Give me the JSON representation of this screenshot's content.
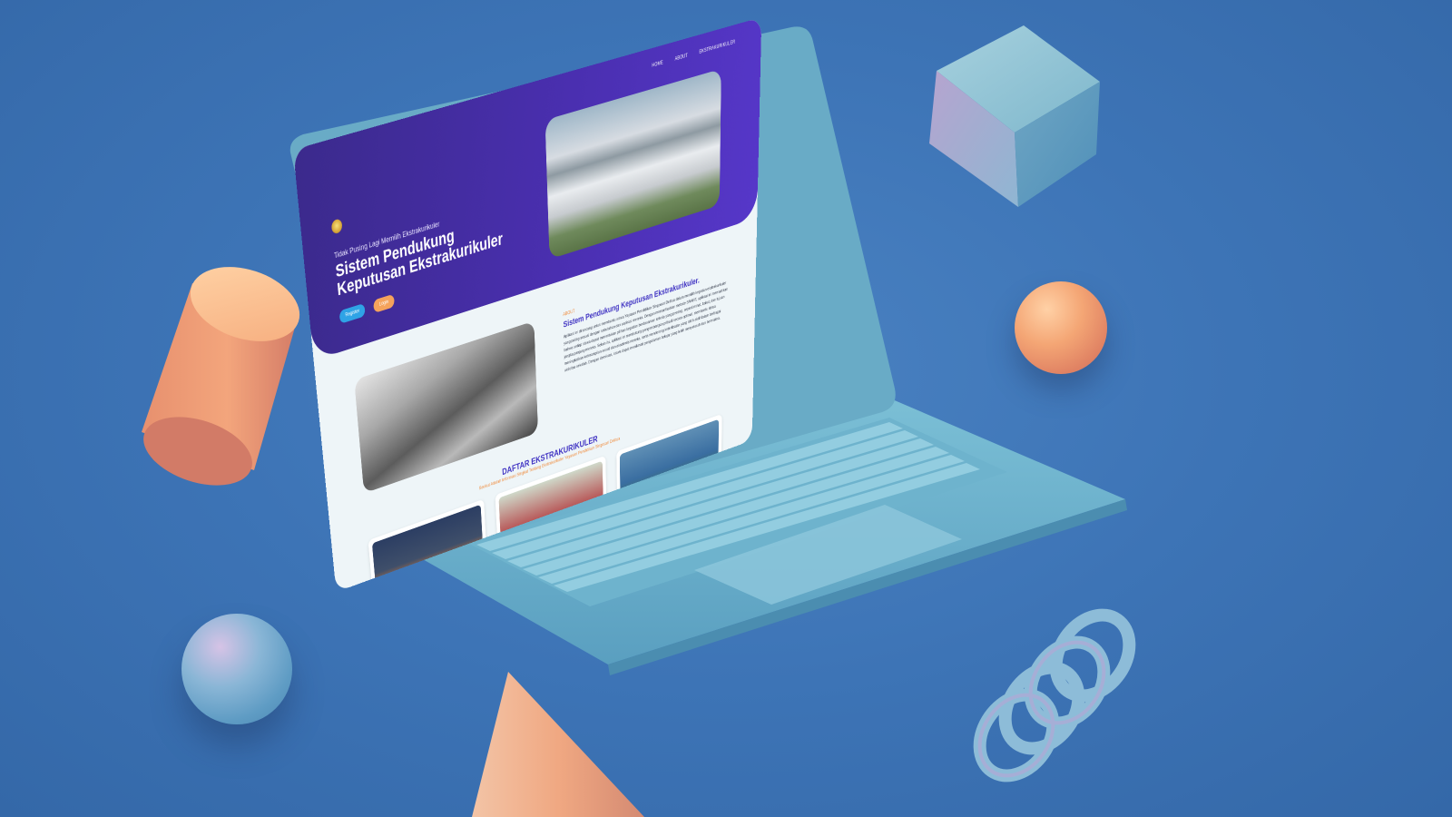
{
  "page": {
    "nav": [
      "HOME",
      "ABOUT",
      "EKSTRAKURIKULER"
    ],
    "hero": {
      "subtitle": "Tidak Pusing Lagi Memilih Ekstrakurikuler",
      "title": "Sistem Pendukung Keputusan Ekstrakurikuler",
      "buttons": {
        "register": "Register",
        "login": "Login"
      }
    },
    "about": {
      "label": "ABOUT",
      "title": "Sistem Pendukung Keputusan Ekstrakurikuler.",
      "body": "Aplikasi ini dirancang untuk membantu siswa Yayasan Pendidikan Singosari Delitua dalam memilih kegiatan ekstrakurikuler yang paling sesuai dengan kebutuhan dan aspirasi mereka. Dengan memanfaatkan metode SMART, aplikasi ini memastikan bahwa setiap siswa dapat menentukan pilihan kegiatan berdasarkan kriteria yang penting, seperti minat, bakat, dan tujuan jangka panjang mereka. Selain itu, aplikasi ini mendukung pengembangan pribadi secara optimal, membantu siswa meningkatkan keterampilan sosial dan akademis mereka, serta mendorong keterlibatan yang lebih aktif dalam berbagai aktivitas sekolah. Dengan demikian, siswa dapat menikmati pengalaman belajar yang lebih menyeluruh dan bermakna."
    },
    "list": {
      "title": "DAFTAR EKSTRAKURIKULER",
      "subtitle": "Berikut Adalah Informasi Singkat Tentang Ekstrakurikuler Yayasan Pendidikan Singosari Delitua"
    }
  },
  "colors": {
    "background": "#3d74b6",
    "hero": "#4a2fb0",
    "accent_orange": "#f08a3a",
    "accent_blue": "#2fa3e6",
    "laptop": "#6fb4cf"
  }
}
